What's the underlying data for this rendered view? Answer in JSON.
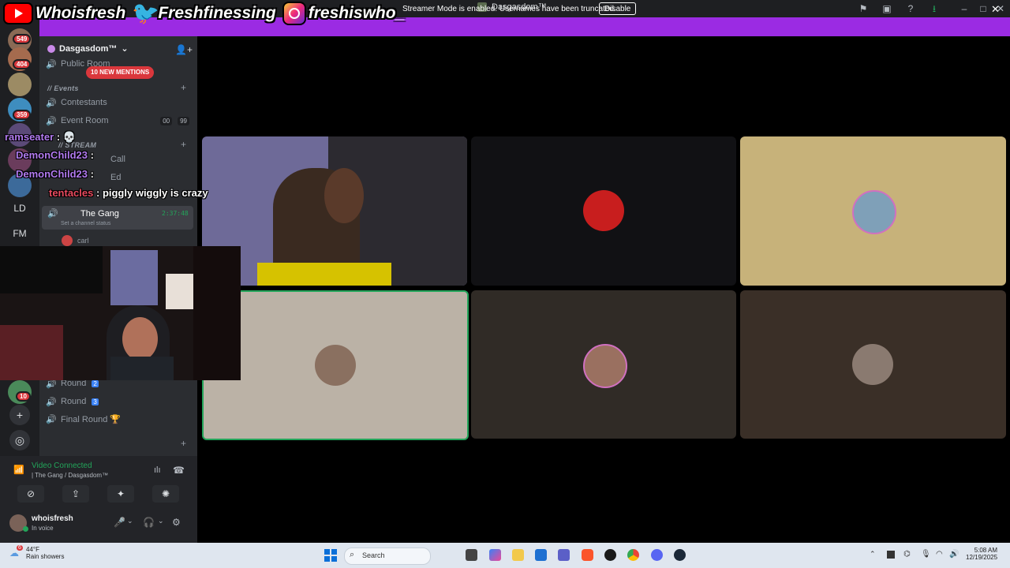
{
  "titlebar": {
    "title": "Dasgasdom™"
  },
  "social": {
    "youtube": "Whoisfresh",
    "twitter": "Freshfinessing",
    "instagram": "freshiswho_"
  },
  "banner": {
    "text": "Streamer Mode is enabled. Usernames have been truncated.",
    "button": "Disable"
  },
  "rail": {
    "badges": [
      "549",
      "404",
      "359",
      "10"
    ],
    "folders": [
      "LD",
      "FM"
    ]
  },
  "server": {
    "name": "Dasgasdom™",
    "mentions": "10 NEW MENTIONS",
    "channels": {
      "public_room": "Public Room",
      "events_category": "// Events",
      "contestants": "Contestants",
      "event_room": "Event Room",
      "event_room_count": "00",
      "event_room_limit": "99",
      "stream_category": "// STREAM",
      "stream_call": "Call",
      "spectator": "Ed",
      "the_gang": "The Gang",
      "the_gang_time": "2:37:48",
      "channel_status": "Set a channel status",
      "member": "carl",
      "round2": "Round",
      "round2_num": "2",
      "round3": "Round",
      "round3_num": "3",
      "final": "Final Round 🏆"
    }
  },
  "chat": [
    {
      "user": "ramseater",
      "sep": " : ",
      "msg": "💀"
    },
    {
      "user": "DemonChild23",
      "sep": " : ",
      "msg": ""
    },
    {
      "user": "DemonChild23",
      "sep": " : ",
      "msg": ""
    },
    {
      "user": "tentacles",
      "sep": " : ",
      "msg": "piggly wiggly is crazy"
    }
  ],
  "voice": {
    "status": "Video Connected",
    "location": "| The Gang / Dasgasdom™"
  },
  "user": {
    "name": "whoisfresh",
    "status": "In voice"
  },
  "taskbar": {
    "weather_badge": "6",
    "temp": "44°F",
    "condition": "Rain showers",
    "search": "Search",
    "time": "5:08 AM",
    "date": "12/19/2025"
  },
  "colors": {
    "banner": "#9b2be3",
    "speaking": "#23a55a",
    "sidebar": "#2b2d31"
  }
}
